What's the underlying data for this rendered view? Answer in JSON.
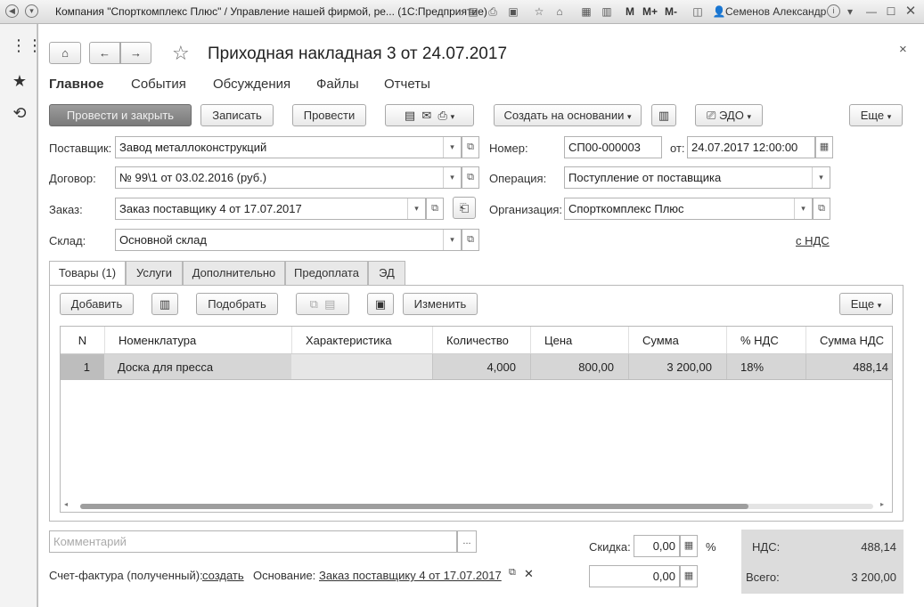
{
  "window": {
    "title": "Компания \"Спорткомплекс Плюс\" / Управление нашей фирмой, ре...  (1С:Предприятие)",
    "user": "Семенов Александр",
    "m": "M",
    "mplus": "M+",
    "mminus": "M-"
  },
  "doc": {
    "title": "Приходная накладная 3 от 24.07.2017",
    "close": "×"
  },
  "nav": {
    "items": [
      "Главное",
      "События",
      "Обсуждения",
      "Файлы",
      "Отчеты"
    ]
  },
  "toolbar": {
    "post_close": "Провести и закрыть",
    "save": "Записать",
    "post": "Провести",
    "create_based": "Создать на основании",
    "edo": "ЭДО",
    "more": "Еще"
  },
  "form": {
    "supplier_label": "Поставщик:",
    "supplier_value": "Завод металлоконструкций",
    "contract_label": "Договор:",
    "contract_value": "№ 99\\1 от 03.02.2016 (руб.)",
    "order_label": "Заказ:",
    "order_value": "Заказ поставщику 4 от 17.07.2017",
    "warehouse_label": "Склад:",
    "warehouse_value": "Основной склад",
    "number_label": "Номер:",
    "number_value": "СП00-000003",
    "from_label": "от:",
    "date_value": "24.07.2017 12:00:00",
    "operation_label": "Операция:",
    "operation_value": "Поступление от поставщика",
    "org_label": "Организация:",
    "org_value": "Спорткомплекс Плюс",
    "vat_link": "с НДС"
  },
  "tabs": [
    "Товары (1)",
    "Услуги",
    "Дополнительно",
    "Предоплата",
    "ЭД"
  ],
  "table_toolbar": {
    "add": "Добавить",
    "pick": "Подобрать",
    "change": "Изменить",
    "more": "Еще"
  },
  "table": {
    "columns": [
      "N",
      "Номенклатура",
      "Характеристика",
      "Количество",
      "Цена",
      "Сумма",
      "% НДС",
      "Сумма НДС"
    ],
    "rows": [
      [
        "1",
        "Доска для пресса",
        "",
        "4,000",
        "800,00",
        "3 200,00",
        "18%",
        "488,14"
      ]
    ]
  },
  "footer": {
    "comment_placeholder": "Комментарий",
    "comment_btn": "...",
    "discount_label": "Скидка:",
    "discount_value": "0,00",
    "percent": "%",
    "sum_value": "0,00",
    "vat_label": "НДС:",
    "vat_value": "488,14",
    "total_label": "Всего:",
    "total_value": "3 200,00",
    "invoice_label": "Счет-фактура (полученный):",
    "invoice_link": "создать",
    "basis_label": "Основание:",
    "basis_link": "Заказ поставщику 4 от 17.07.2017"
  }
}
